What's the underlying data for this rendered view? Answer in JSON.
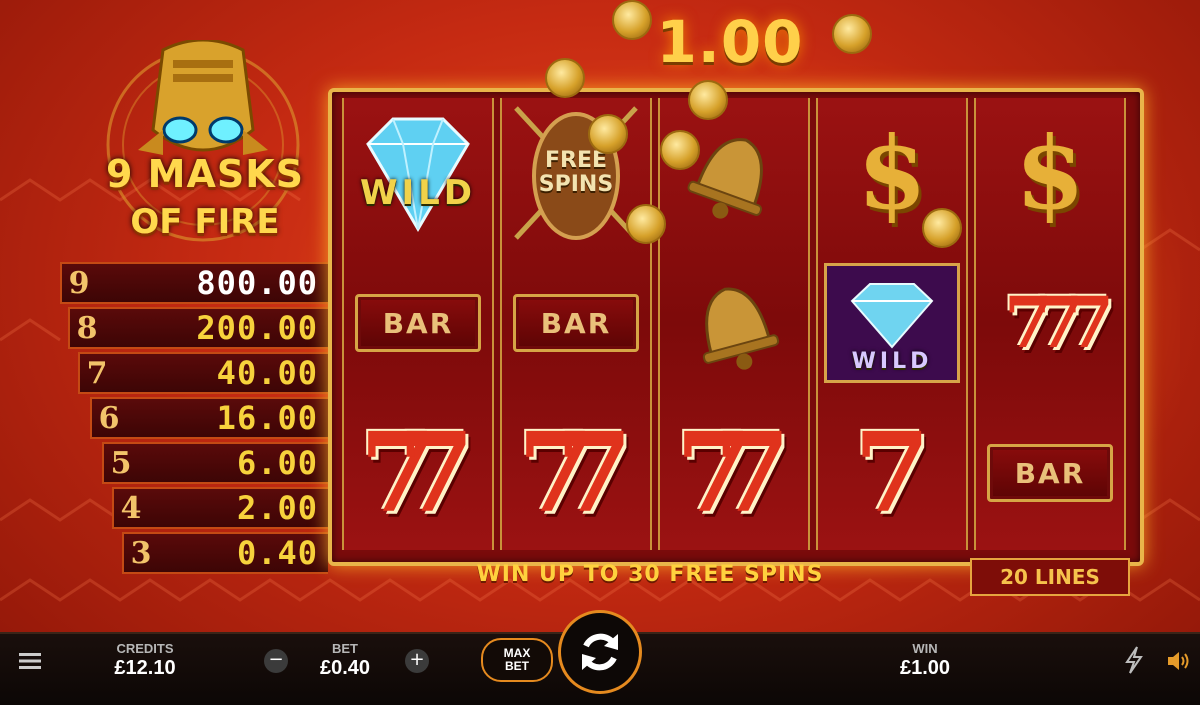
{
  "game": {
    "title_line1": "9 MASKS",
    "title_line2": "OF FIRE",
    "trademark": "™",
    "top_win": "1.00"
  },
  "paytable": [
    {
      "count": "9",
      "value": "800.00"
    },
    {
      "count": "8",
      "value": "200.00"
    },
    {
      "count": "7",
      "value": "40.00"
    },
    {
      "count": "6",
      "value": "16.00"
    },
    {
      "count": "5",
      "value": "6.00"
    },
    {
      "count": "4",
      "value": "2.00"
    },
    {
      "count": "3",
      "value": "0.40"
    }
  ],
  "reels": {
    "reel1": {
      "top": "WILD",
      "middle": "BAR",
      "bottom": "77"
    },
    "reel2": {
      "top": "FREE SPINS",
      "middle": "BAR",
      "bottom": "77"
    },
    "reel3": {
      "top": "bell",
      "middle": "bell",
      "bottom": "77"
    },
    "reel4": {
      "top": "$",
      "middle": "WILD",
      "bottom": "7"
    },
    "reel5": {
      "top": "$",
      "middle": "777",
      "bottom": "BAR"
    }
  },
  "symbols": {
    "wild": "WILD",
    "free_line1": "FREE",
    "free_line2": "SPINS",
    "bar": "BAR",
    "seven_double": "77",
    "seven_single": "7",
    "seven_triple": "777",
    "dollar": "$"
  },
  "promo_text": "WIN UP TO 30 FREE SPINS",
  "lines_text": "20 LINES",
  "bottom_bar": {
    "credits_label": "CREDITS",
    "credits_value": "£12.10",
    "bet_label": "BET",
    "bet_value": "£0.40",
    "minus": "−",
    "plus": "+",
    "maxbet_line1": "MAX",
    "maxbet_line2": "BET",
    "win_label": "WIN",
    "win_value": "£1.00"
  },
  "icons": [
    "menu-icon",
    "minus-icon",
    "plus-icon",
    "spin-icon",
    "turbo-lightning-icon",
    "sound-icon"
  ],
  "colors": {
    "accent_orange": "#e58a1f",
    "gold": "#ffd04a",
    "background_red": "#c52a12"
  }
}
